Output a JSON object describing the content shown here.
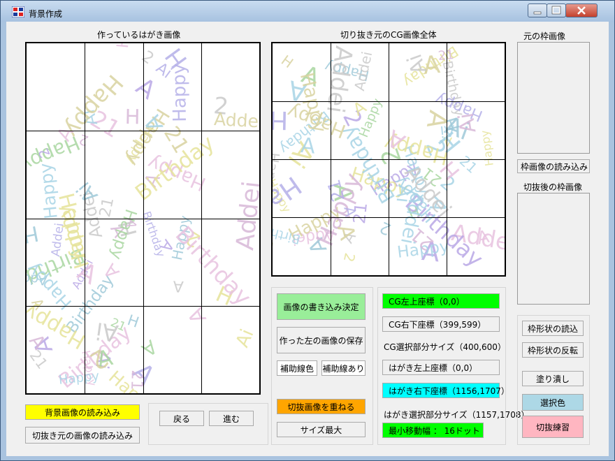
{
  "window": {
    "title": "背景作成"
  },
  "colors": {
    "yellow": "#ffff00",
    "green": "#00ff00",
    "light_green": "#99ee99",
    "cyan": "#00ffff",
    "orange": "#ffa500",
    "light_blue": "#add8e6",
    "pink": "#ffb6c1"
  },
  "left_panel": {
    "label": "作っているはがき画像",
    "load_background": "背景画像の読み込み",
    "load_source": "切抜き元の画像の読み込み",
    "back": "戻る",
    "forward": "進む"
  },
  "middle_panel": {
    "label": "切り抜き元のCG画像全体",
    "confirm_write": "画像の書き込み決定",
    "save_left": "作った左の画像の保存",
    "guide_color": "補助線色",
    "guide_on": "補助線あり",
    "overlay": "切抜画像を重ねる",
    "max_size": "サイズ最大"
  },
  "coords": {
    "cg_top_left": "CG左上座標（0,0）",
    "cg_bottom_right": "CG右下座標（399,599）",
    "cg_select_size": "CG選択部分サイズ（400,600）",
    "card_top_left": "はがき左上座標（0,0）",
    "card_bottom_right": "はがき右下座標（1156,1707）",
    "card_select_size": "はがき選択部分サイズ（1157,1708）",
    "min_step": "最小移動幅 ： 16ドット"
  },
  "right_panel": {
    "frame_label": "元の枠画像",
    "load_frame": "枠画像の読み込み",
    "cropped_label": "切抜後の枠画像",
    "load_shape": "枠形状の読込",
    "invert_shape": "枠形状の反転",
    "fill": "塗り潰し",
    "select_color": "選択色",
    "practice": "切抜練習"
  },
  "decor": [
    "Happy",
    "Addei",
    "Happy",
    "A",
    "21",
    "Birthday",
    "A",
    "Happy",
    "Ai",
    "2",
    "A",
    "H"
  ]
}
